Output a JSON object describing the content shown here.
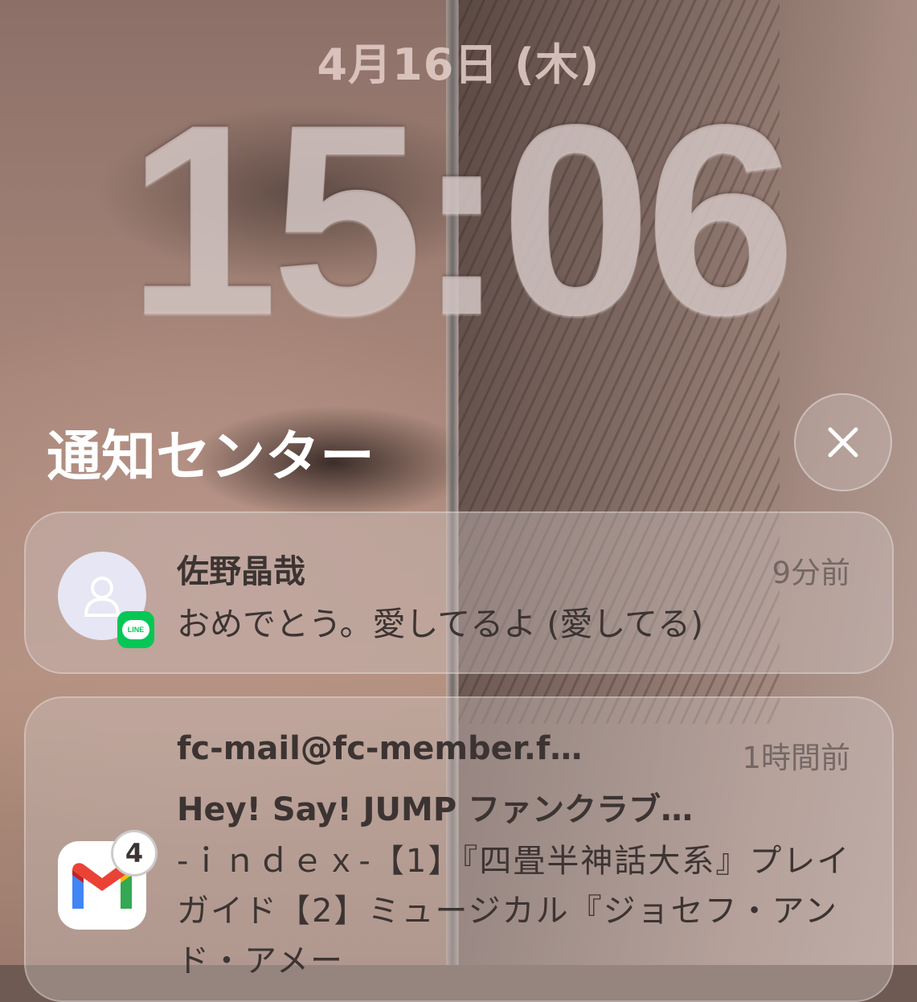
{
  "lock_screen": {
    "date": "4月16日 (木)",
    "time": "15:06"
  },
  "notification_center": {
    "title": "通知センター",
    "close_icon": "close-x-icon",
    "notifications": [
      {
        "app": "LINE",
        "app_badge_text": "LINE",
        "avatar_icon": "person-placeholder-icon",
        "sender": "佐野晶哉",
        "time_ago": "9分前",
        "message": "おめでとう。愛してるよ (愛してる)"
      },
      {
        "app": "Gmail",
        "unread_count": "4",
        "sender": "fc-mail@fc-member.f…",
        "time_ago": "1時間前",
        "subject": "Hey! Say! JUMP ファンクラブ…",
        "body": "-ｉｎｄｅｘ-【1】『四畳半神話大系』プレイガイド【2】ミュージカル『ジョセフ・アンド・アメー"
      }
    ]
  },
  "colors": {
    "line_green": "#06c755",
    "gmail_red": "#ea4335",
    "gmail_blue": "#4285f4",
    "gmail_green": "#34a853",
    "gmail_yellow": "#fbbc04"
  }
}
